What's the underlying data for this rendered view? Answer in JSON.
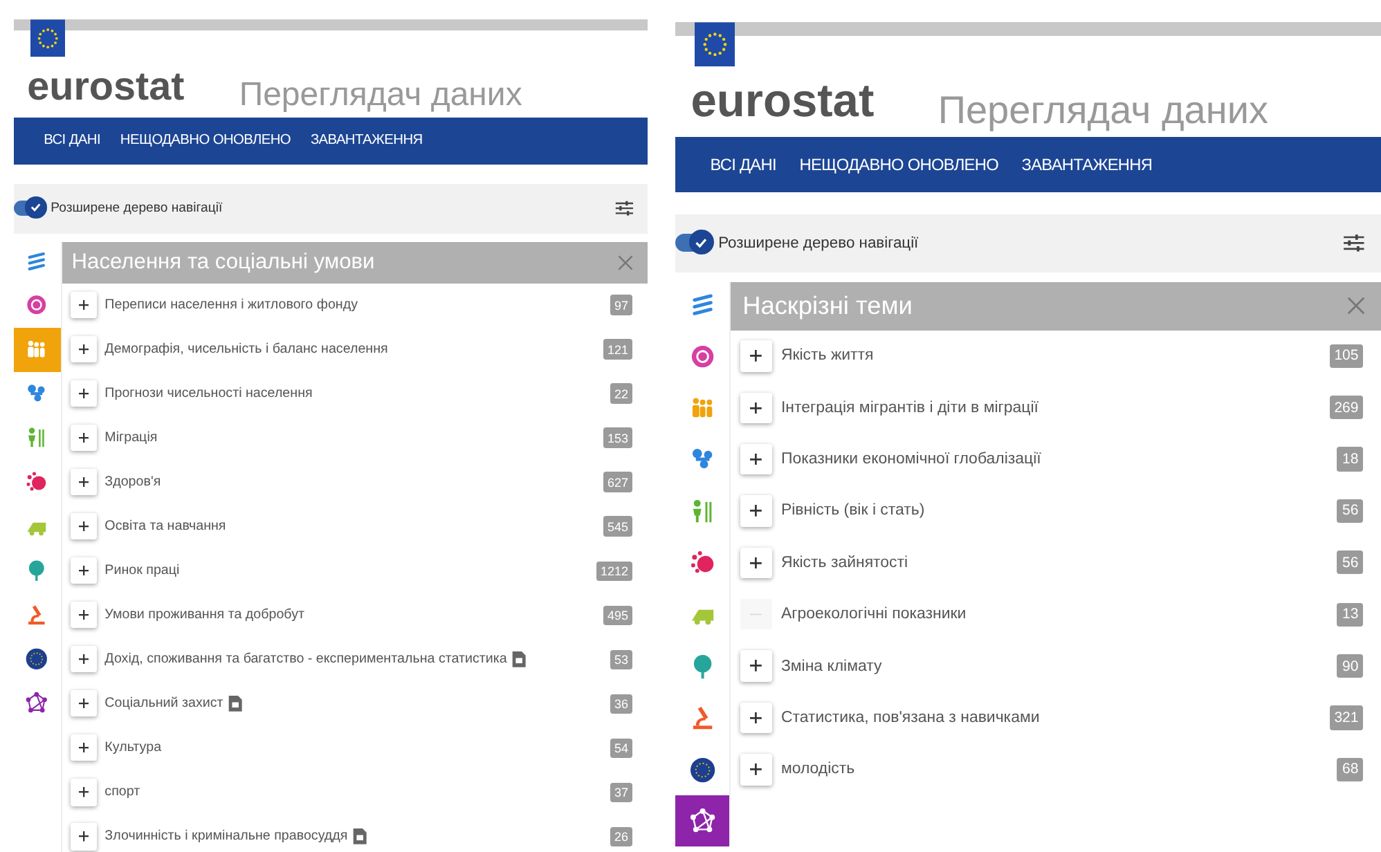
{
  "panels": [
    {
      "logo": "eurostat",
      "subtitle": "Переглядач даних",
      "nav": [
        "ВСІ ДАНІ",
        "НЕЩОДАВНО ОНОВЛЕНО",
        "ЗАВАНТАЖЕННЯ"
      ],
      "toggle": {
        "label": "Розширене дерево навігації",
        "checked": true
      },
      "title": "Населення та соціальні умови",
      "icons": [
        {
          "kind": "lines",
          "color": "#2e86de",
          "selected": false
        },
        {
          "kind": "ring",
          "color": "#d63fa3",
          "selected": false
        },
        {
          "kind": "people",
          "color": "#f0a30a",
          "selected": true
        },
        {
          "kind": "nodes",
          "color": "#2e86de",
          "selected": false
        },
        {
          "kind": "figures",
          "color": "#5cb531",
          "selected": false
        },
        {
          "kind": "dots",
          "color": "#e0245e",
          "selected": false
        },
        {
          "kind": "leaf",
          "color": "#a4c639",
          "selected": false
        },
        {
          "kind": "tree",
          "color": "#26a69a",
          "selected": false
        },
        {
          "kind": "microscope",
          "color": "#f05a28",
          "selected": false
        },
        {
          "kind": "eu",
          "color": "#1d3f8f",
          "selected": false
        },
        {
          "kind": "molecule",
          "color": "#8e24aa",
          "selected": false
        }
      ],
      "items": [
        {
          "label": "Переписи населення і житлового фонду",
          "count": "97",
          "expandable": true,
          "document": false
        },
        {
          "label": "Демографія, чисельність і баланс населення",
          "count": "121",
          "expandable": true,
          "document": false
        },
        {
          "label": "Прогнози чисельності населення",
          "count": "22",
          "expandable": true,
          "document": false
        },
        {
          "label": "Міграція",
          "count": "153",
          "expandable": true,
          "document": false
        },
        {
          "label": "Здоров'я",
          "count": "627",
          "expandable": true,
          "document": false
        },
        {
          "label": "Освіта та навчання",
          "count": "545",
          "expandable": true,
          "document": false
        },
        {
          "label": "Ринок праці",
          "count": "1212",
          "expandable": true,
          "document": false
        },
        {
          "label": "Умови проживання та добробут",
          "count": "495",
          "expandable": true,
          "document": false
        },
        {
          "label": "Дохід, споживання та багатство - експериментальна статистика",
          "count": "53",
          "expandable": true,
          "document": true
        },
        {
          "label": "Соціальний захист",
          "count": "36",
          "expandable": true,
          "document": true
        },
        {
          "label": "Культура",
          "count": "54",
          "expandable": true,
          "document": false
        },
        {
          "label": "спорт",
          "count": "37",
          "expandable": true,
          "document": false
        },
        {
          "label": "Злочинність і кримінальне правосуддя",
          "count": "26",
          "expandable": true,
          "document": true
        }
      ]
    },
    {
      "logo": "eurostat",
      "subtitle": "Переглядач даних",
      "nav": [
        "ВСІ ДАНІ",
        "НЕЩОДАВНО ОНОВЛЕНО",
        "ЗАВАНТАЖЕННЯ"
      ],
      "toggle": {
        "label": "Розширене дерево навігації",
        "checked": true
      },
      "title": "Наскрізні теми",
      "icons": [
        {
          "kind": "lines",
          "color": "#2e86de",
          "selected": false
        },
        {
          "kind": "ring",
          "color": "#d63fa3",
          "selected": false
        },
        {
          "kind": "people",
          "color": "#f0a30a",
          "selected": false
        },
        {
          "kind": "nodes",
          "color": "#2e86de",
          "selected": false
        },
        {
          "kind": "figures",
          "color": "#5cb531",
          "selected": false
        },
        {
          "kind": "dots",
          "color": "#e0245e",
          "selected": false
        },
        {
          "kind": "leaf",
          "color": "#a4c639",
          "selected": false
        },
        {
          "kind": "tree",
          "color": "#26a69a",
          "selected": false
        },
        {
          "kind": "microscope",
          "color": "#f05a28",
          "selected": false
        },
        {
          "kind": "eu",
          "color": "#1d3f8f",
          "selected": false
        },
        {
          "kind": "molecule",
          "color": "#8e24aa",
          "selected": true
        }
      ],
      "items": [
        {
          "label": "Якість життя",
          "count": "105",
          "expandable": true,
          "document": false
        },
        {
          "label": "Інтеграція мігрантів і діти в міграції",
          "count": "269",
          "expandable": true,
          "document": false
        },
        {
          "label": "Показники економічної глобалізації",
          "count": "18",
          "expandable": true,
          "document": false
        },
        {
          "label": "Рівність (вік і стать)",
          "count": "56",
          "expandable": true,
          "document": false
        },
        {
          "label": "Якість зайнятості",
          "count": "56",
          "expandable": true,
          "document": false
        },
        {
          "label": "Агроекологічні показники",
          "count": "13",
          "expandable": false,
          "document": false
        },
        {
          "label": "Зміна клімату",
          "count": "90",
          "expandable": true,
          "document": false
        },
        {
          "label": "Статистика, пов'язана з навичками",
          "count": "321",
          "expandable": true,
          "document": false
        },
        {
          "label": "молодість",
          "count": "68",
          "expandable": true,
          "document": false
        }
      ]
    }
  ]
}
